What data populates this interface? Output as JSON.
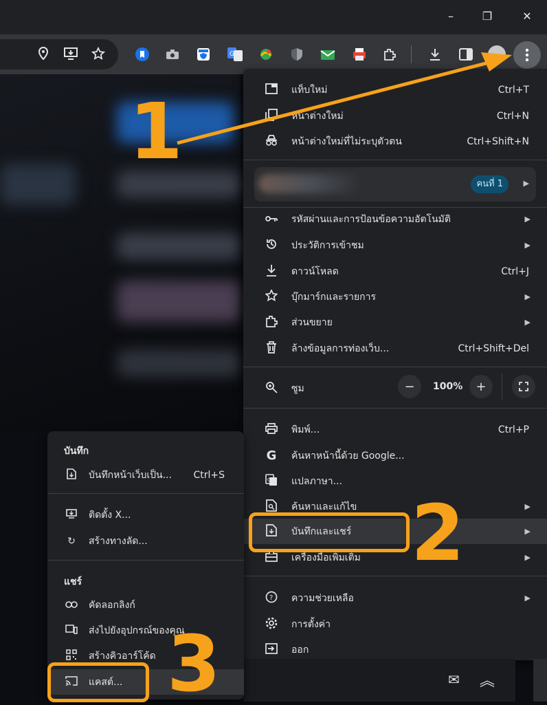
{
  "window": {
    "minimize": "–",
    "maximize": "❐",
    "close": "✕"
  },
  "toolbar_icons": [
    "location-icon",
    "install-app-icon",
    "bookmark-star-icon",
    "bookmark-ext-icon",
    "camera-icon",
    "shield-ext-icon",
    "translate-ext-icon",
    "map-ext-icon",
    "security-ext-icon",
    "mail-ext-icon",
    "print-ext-icon",
    "extensions-icon",
    "download-icon",
    "sidepanel-icon",
    "avatar",
    "menu-dots-icon"
  ],
  "menu": {
    "new_tab": {
      "label": "แท็บใหม่",
      "shortcut": "Ctrl+T"
    },
    "new_window": {
      "label": "หน้าต่างใหม่",
      "shortcut": "Ctrl+N"
    },
    "incognito": {
      "label": "หน้าต่างใหม่ที่ไม่ระบุตัวตน",
      "shortcut": "Ctrl+Shift+N"
    },
    "profile_badge": "คนที่ 1",
    "passwords": {
      "label": "รหัสผ่านและการป้อนข้อความอัตโนมัติ"
    },
    "history": {
      "label": "ประวัติการเข้าชม"
    },
    "downloads": {
      "label": "ดาวน์โหลด",
      "shortcut": "Ctrl+J"
    },
    "bookmarks": {
      "label": "บุ๊กมาร์กและรายการ"
    },
    "extensions": {
      "label": "ส่วนขยาย"
    },
    "clear_data": {
      "label": "ล้างข้อมูลการท่องเว็บ...",
      "shortcut": "Ctrl+Shift+Del"
    },
    "zoom": {
      "label": "ซูม",
      "minus": "−",
      "value": "100%",
      "plus": "+"
    },
    "print": {
      "label": "พิมพ์...",
      "shortcut": "Ctrl+P"
    },
    "search_google": {
      "label": "ค้นหาหน้านี้ด้วย Google..."
    },
    "translate": {
      "label": "แปลภาษา..."
    },
    "find_edit": {
      "label": "ค้นหาและแก้ไข"
    },
    "save_share": {
      "label": "บันทึกและแชร์"
    },
    "more_tools": {
      "label": "เครื่องมือเพิ่มเติม"
    },
    "help": {
      "label": "ความช่วยเหลือ"
    },
    "settings": {
      "label": "การตั้งค่า"
    },
    "exit": {
      "label": "ออก"
    }
  },
  "submenu": {
    "save_heading": "บันทึก",
    "save_page": {
      "label": "บันทึกหน้าเว็บเป็น...",
      "shortcut": "Ctrl+S"
    },
    "install": {
      "label": "ติดตั้ง X..."
    },
    "shortcut": {
      "label": "สร้างทางลัด..."
    },
    "share_heading": "แชร์",
    "copy_link": {
      "label": "คัดลอกลิงก์"
    },
    "send_devices": {
      "label": "ส่งไปยังอุปกรณ์ของคุณ"
    },
    "qr": {
      "label": "สร้างคิวอาร์โค้ด"
    },
    "cast": {
      "label": "แคสต์..."
    }
  },
  "annotations": {
    "step1": "1",
    "step2": "2",
    "step3": "3"
  },
  "colors": {
    "accent": "#f7a21b",
    "menu_bg": "#202124",
    "badge_bg": "#0f4f6e"
  }
}
